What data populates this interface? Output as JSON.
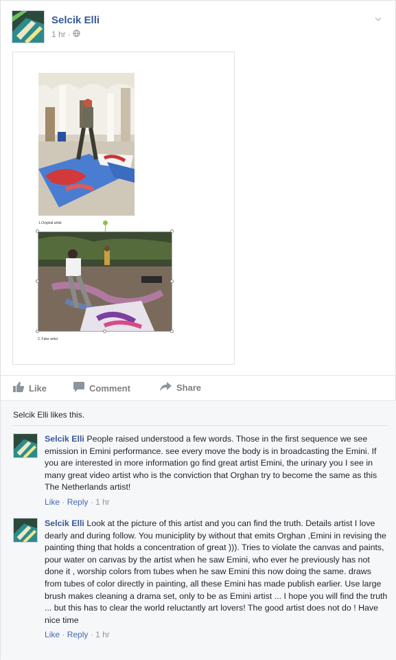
{
  "post": {
    "author": "Selcik Elli",
    "time": "1 hr",
    "audience_separator": "·",
    "audience_icon": "globe-icon",
    "image": {
      "caption1": "1.Original artist",
      "caption2": "2. Fake artist"
    }
  },
  "actions": {
    "like": "Like",
    "comment": "Comment",
    "share": "Share"
  },
  "likes_summary": "Selcik Elli likes this.",
  "comments": [
    {
      "author": "Selcik Elli",
      "text": "People raised understood a few words. Those in the first sequence we see emission in Emini performance. see every move the body is in broadcasting the Emini. If you are interested in more information go find great artist Emini, the urinary you I see in many great video artist who is the conviction that Orghan try to become the same as this The Netherlands artist!",
      "like": "Like",
      "reply": "Reply",
      "time": "1 hr",
      "sep": "·"
    },
    {
      "author": "Selcik Elli",
      "text": "Look at the picture of this artist and you can find the truth. Details artist I love dearly and during follow. You municiplity by without that emits Orghan ,Emini in revising the painting thing that holds a concentration of great ))). Tries to violate the canvas and paints, pour water on canvas by the artist when he saw Emini, who ever he previously has not done it , worship colors from tubes when he saw Emini this now doing the same. draws from tubes of color directly in painting, all these Emini has made publish earlier. Use large brush makes cleaning a drama set, only to be as Emini artist ... I hope you will find the truth ... but this has to clear the world reluctantly art lovers! The good artist does not do ! Have nice time",
      "like": "Like",
      "reply": "Reply",
      "time": "1 hr",
      "sep": "·"
    }
  ]
}
